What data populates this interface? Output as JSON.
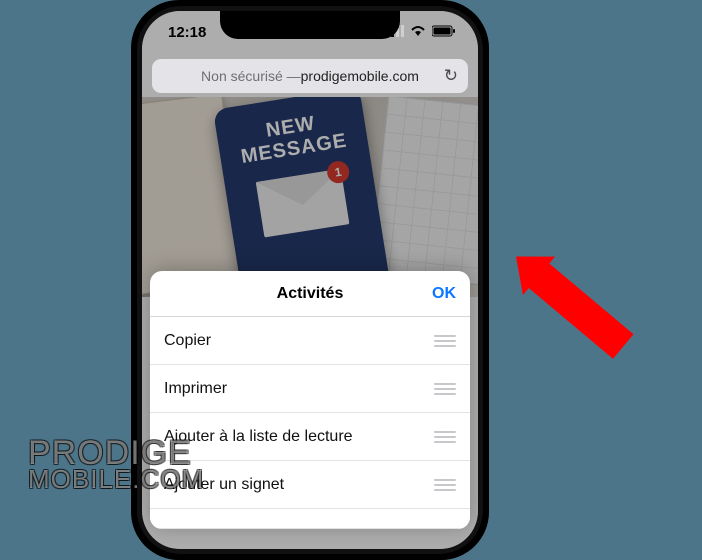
{
  "status": {
    "time": "12:18"
  },
  "urlbar": {
    "prefix": "Non sécurisé — ",
    "domain": "prodigemobile.com"
  },
  "page_content": {
    "new_message_line1": "NEW",
    "new_message_line2": "MESSAGE",
    "badge": "1"
  },
  "sheet": {
    "title": "Activités",
    "ok": "OK",
    "items": [
      "Copier",
      "Imprimer",
      "Ajouter à la liste de lecture",
      "Ajouter un signet"
    ]
  },
  "watermark": {
    "line1": "PRODIGE",
    "line2": "MOBILE.COM"
  }
}
